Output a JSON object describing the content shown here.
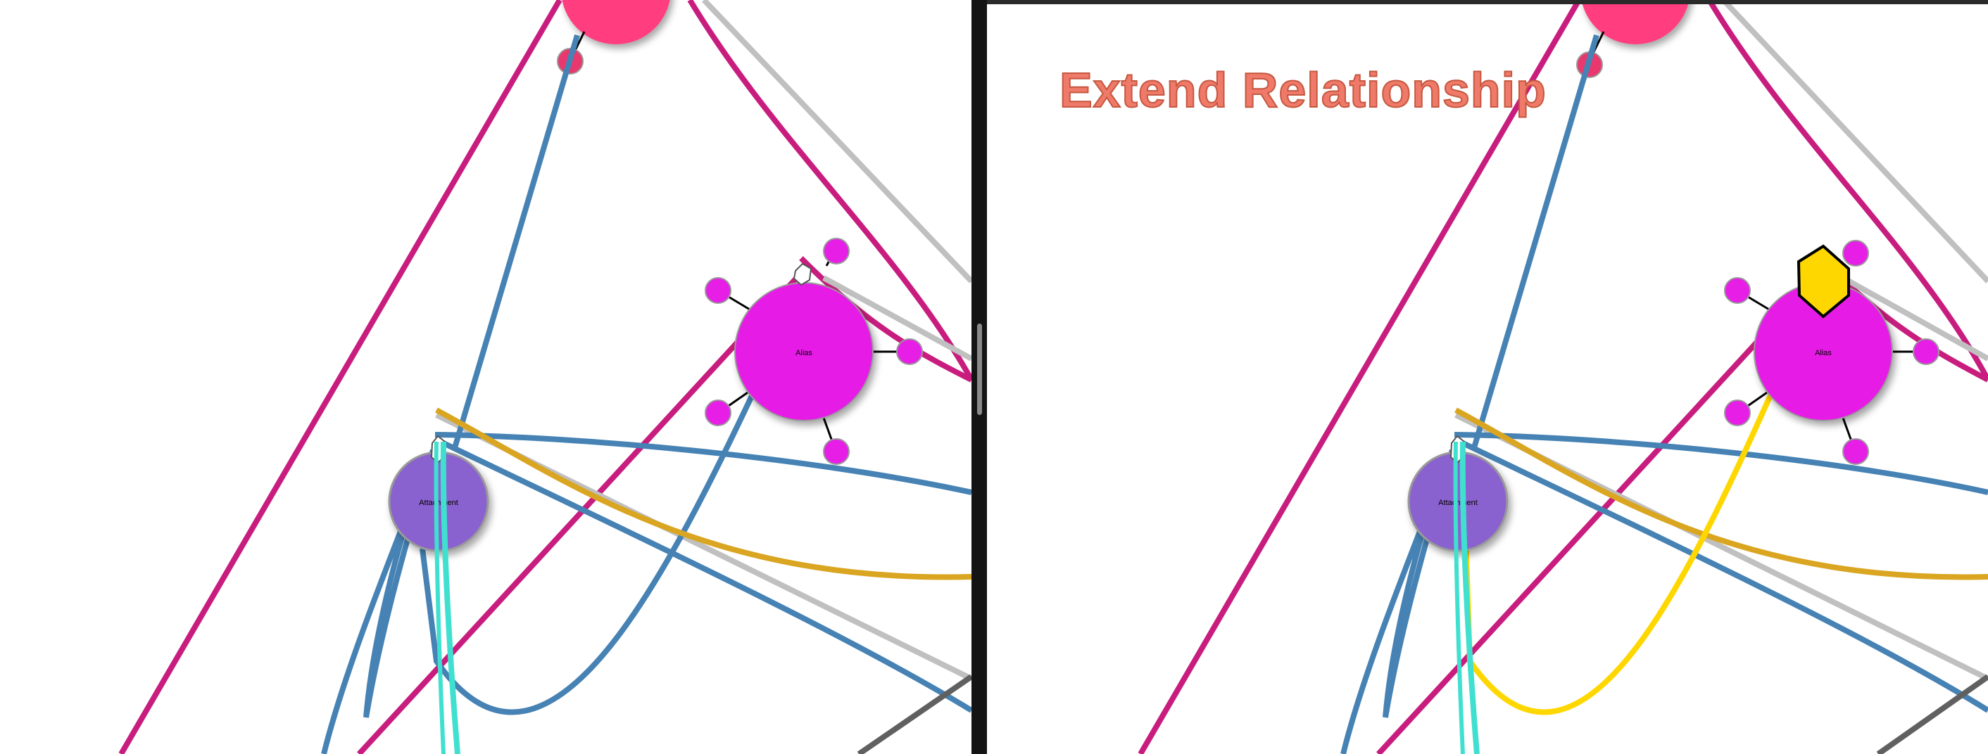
{
  "panels": {
    "right_title": "Extend Relationship"
  },
  "nodes": {
    "alias_label": "Alias",
    "attachment_label": "Attachment"
  },
  "colors": {
    "magenta_line": "#c81d7e",
    "steel_blue": "#4682b4",
    "gold": "#daa520",
    "silver": "#c0c0c0",
    "turquoise": "#40e0d0",
    "highlight_yellow": "#ffd700",
    "pink_node": "#ff3d7f",
    "alias_node": "#e61ee6",
    "attachment_node": "#8a62cf",
    "dark_gray": "#606060"
  }
}
